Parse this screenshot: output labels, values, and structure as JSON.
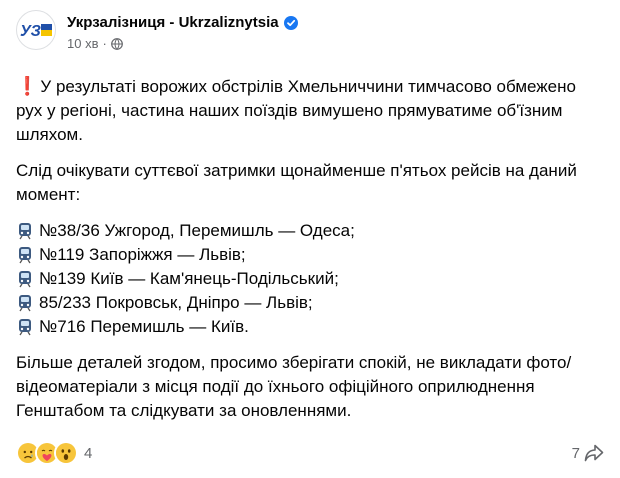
{
  "post": {
    "page_name": "Укрзалізниця - Ukrzaliznytsia",
    "logo_text": "УЗ",
    "time": "10 хв",
    "separator": "·",
    "verified_icon": "verified-badge-icon",
    "audience_icon": "globe-icon",
    "alert_icon": "red-exclamation-icon",
    "alert_mark": "❗",
    "paragraph1": "У результаті ворожих обстрілів Хмельниччини тимчасово обмежено рух у регіоні, частина наших поїздів вимушено прямуватиме об'їзним шляхом.",
    "paragraph2": "Слід очікувати суттєвої затримки щонайменше п'ятьох рейсів на даний момент:",
    "train_icon": "train-icon",
    "routes": [
      "№38/36 Ужгород, Перемишль — Одеса;",
      "№119 Запоріжжя — Львів;",
      "№139 Київ — Кам'янець-Подільський;",
      "85/233 Покровськ, Дніпро — Львів;",
      "№716 Перемишль — Київ."
    ],
    "paragraph3": "Більше деталей згодом, просимо зберігати спокій, не викладати фото/відеоматеріали з місця події до їхнього офіційного оприлюднення Генштабом та слідкувати за оновленнями."
  },
  "footer": {
    "reaction_icons": [
      "sad-emoji-icon",
      "care-emoji-icon",
      "wow-emoji-icon"
    ],
    "reaction_count": "4",
    "share_count": "7",
    "share_icon": "share-arrow-icon"
  },
  "colors": {
    "brand_blue": "#1f4fa8",
    "brand_yellow": "#f5c400",
    "verified_blue": "#1877f2",
    "secondary_text": "#65676b",
    "alert_red": "#e02424"
  }
}
